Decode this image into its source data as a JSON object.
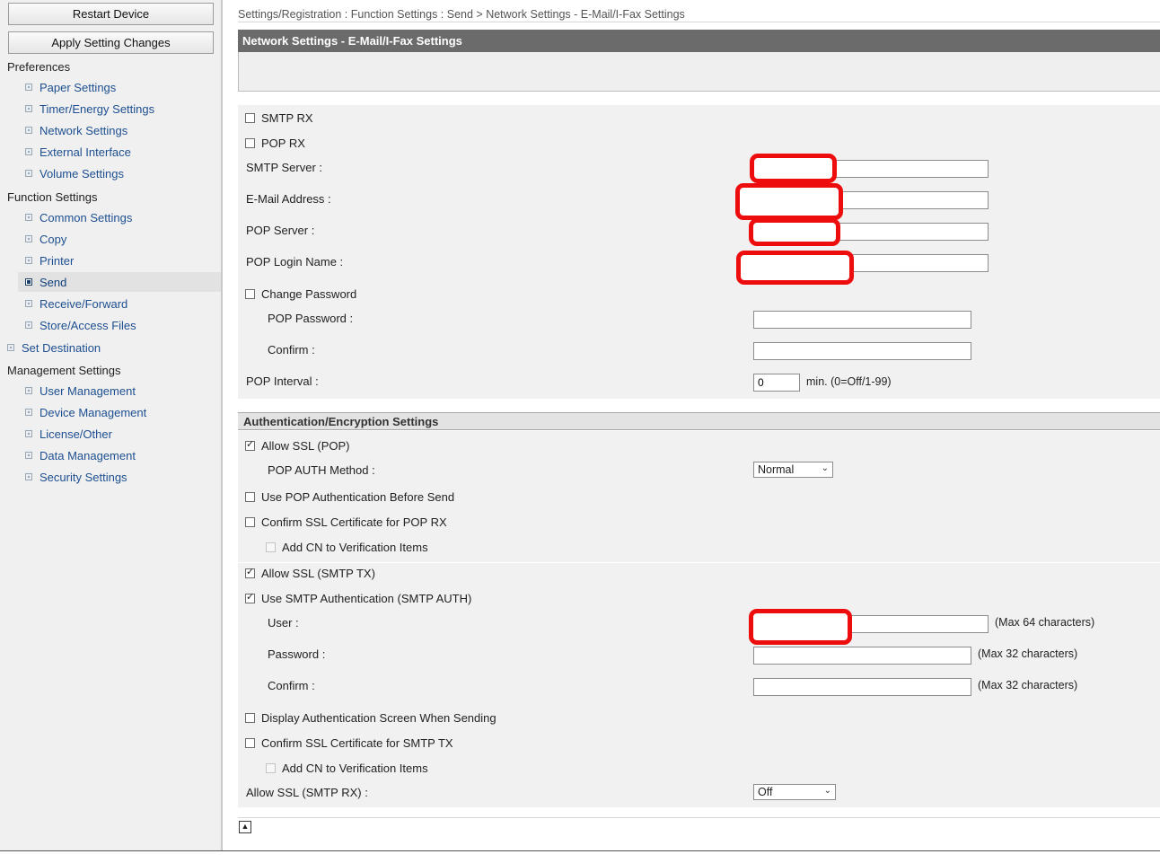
{
  "sidebar": {
    "restart_button": "Restart Device",
    "apply_button": "Apply Setting Changes",
    "preferences": {
      "heading": "Preferences",
      "items": [
        "Paper Settings",
        "Timer/Energy Settings",
        "Network Settings",
        "External Interface",
        "Volume Settings"
      ]
    },
    "function_settings": {
      "heading": "Function Settings",
      "items": [
        "Common Settings",
        "Copy",
        "Printer",
        "Send",
        "Receive/Forward",
        "Store/Access Files"
      ]
    },
    "selected_item": "Send",
    "set_destination": "Set Destination",
    "management": {
      "heading": "Management Settings",
      "items": [
        "User Management",
        "Device Management",
        "License/Other",
        "Data Management",
        "Security Settings"
      ]
    }
  },
  "breadcrumb": "Settings/Registration : Function Settings : Send > Network Settings - E-Mail/I-Fax Settings",
  "page_title": "Network Settings - E-Mail/I-Fax Settings",
  "general": {
    "smtp_rx": {
      "label": "SMTP RX",
      "checked": false
    },
    "pop_rx": {
      "label": "POP RX",
      "checked": false
    },
    "smtp_server_label": "SMTP Server :",
    "email_label": "E-Mail Address :",
    "pop_server_label": "POP Server :",
    "pop_login_label": "POP Login Name :",
    "change_password": {
      "label": "Change Password",
      "checked": false
    },
    "pop_password_label": "POP Password :",
    "confirm_label": "Confirm :",
    "pop_interval_label": "POP Interval :",
    "pop_interval_value": "0",
    "pop_interval_note": "min. (0=Off/1-99)"
  },
  "auth": {
    "heading": "Authentication/Encryption Settings",
    "allow_ssl_pop": {
      "label": "Allow SSL (POP)",
      "checked": true
    },
    "pop_auth_method_label": "POP AUTH Method :",
    "pop_auth_method_value": "Normal",
    "use_pop_before_send": {
      "label": "Use POP Authentication Before Send",
      "checked": false
    },
    "confirm_ssl_pop": {
      "label": "Confirm SSL Certificate for POP RX",
      "checked": false
    },
    "add_cn_1": {
      "label": "Add CN to Verification Items",
      "checked": false
    },
    "allow_ssl_smtp_tx": {
      "label": "Allow SSL (SMTP TX)",
      "checked": true
    },
    "use_smtp_auth": {
      "label": "Use SMTP Authentication (SMTP AUTH)",
      "checked": true
    },
    "user_label": "User :",
    "user_note": "(Max 64 characters)",
    "password_label": "Password :",
    "password_note": "(Max 32 characters)",
    "confirm_label": "Confirm :",
    "confirm_note": "(Max 32 characters)",
    "display_auth_screen": {
      "label": "Display Authentication Screen When Sending",
      "checked": false
    },
    "confirm_ssl_smtp": {
      "label": "Confirm SSL Certificate for SMTP TX",
      "checked": false
    },
    "add_cn_2": {
      "label": "Add CN to Verification Items",
      "checked": false
    },
    "allow_ssl_smtp_rx_label": "Allow SSL (SMTP RX) :",
    "allow_ssl_smtp_rx_value": "Off"
  },
  "colors": {
    "redaction": "#ee0d0d",
    "title_bar": "#6b6b6b",
    "link": "#1d4f91"
  }
}
